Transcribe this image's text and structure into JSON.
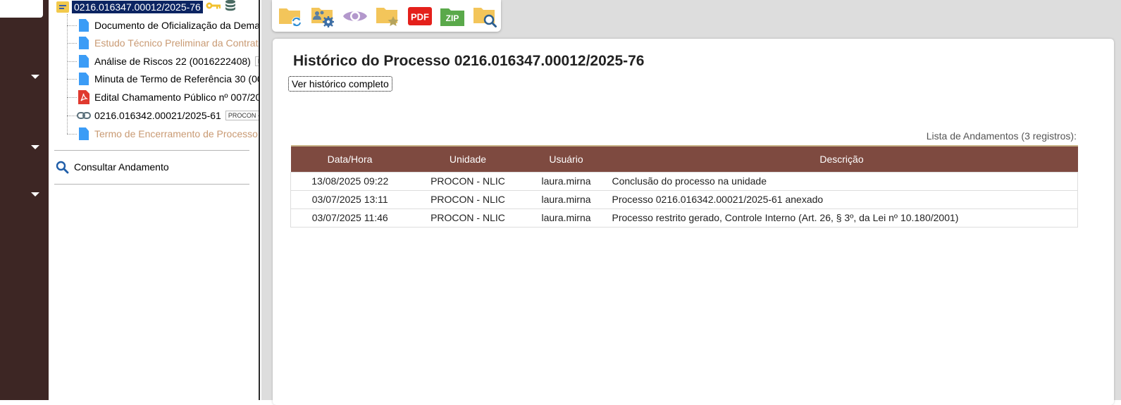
{
  "tree": {
    "root_label": "0216.016347.00012/2025-76",
    "nodes": [
      {
        "label": "Documento de Oficialização da Dema",
        "icon": "document-icon",
        "muted": false,
        "tag": ""
      },
      {
        "label": "Estudo Técnico Preliminar da Contrata",
        "icon": "document-icon",
        "muted": true,
        "tag": ""
      },
      {
        "label": "Análise de Riscos 22 (0016222408)",
        "icon": "document-icon",
        "muted": false,
        "tag": "P"
      },
      {
        "label": "Minuta de Termo de Referência 30 (00",
        "icon": "document-icon",
        "muted": false,
        "tag": ""
      },
      {
        "label": "Edital Chamamento Público nº 007/20",
        "icon": "pdf-icon",
        "muted": false,
        "tag": ""
      },
      {
        "label": "0216.016342.00021/2025-61",
        "icon": "link-icon",
        "muted": false,
        "tag": "PROCON -"
      },
      {
        "label": "Termo de Encerramento de Processo",
        "icon": "document-icon",
        "muted": true,
        "tag": ""
      }
    ],
    "consult_label": "Consultar Andamento"
  },
  "toolbar": {
    "buttons": [
      "folder-refresh-icon",
      "folder-users-settings-icon",
      "eye-icon",
      "folder-star-icon",
      "pdf-icon",
      "zip-icon",
      "folder-search-icon"
    ],
    "pdf_text": "PDF",
    "zip_text": "ZIP"
  },
  "main": {
    "title": "Histórico do Processo 0216.016347.00012/2025-76",
    "full_history_label": "Ver histórico completo",
    "caption": "Lista de Andamentos (3 registros):",
    "columns": [
      "Data/Hora",
      "Unidade",
      "Usuário",
      "Descrição"
    ],
    "rows": [
      [
        "13/08/2025 09:22",
        "PROCON - NLIC",
        "laura.mirna",
        "Conclusão do processo na unidade"
      ],
      [
        "03/07/2025 13:11",
        "PROCON - NLIC",
        "laura.mirna",
        "Processo 0216.016342.00021/2025-61 anexado"
      ],
      [
        "03/07/2025 11:46",
        "PROCON - NLIC",
        "laura.mirna",
        "Processo restrito gerado, Controle Interno (Art. 26, § 3º, da Lei nº 10.180/2001)"
      ]
    ]
  },
  "colors": {
    "rail": "#3d2624",
    "header": "#7e4a40",
    "selected": "#0b2462"
  }
}
